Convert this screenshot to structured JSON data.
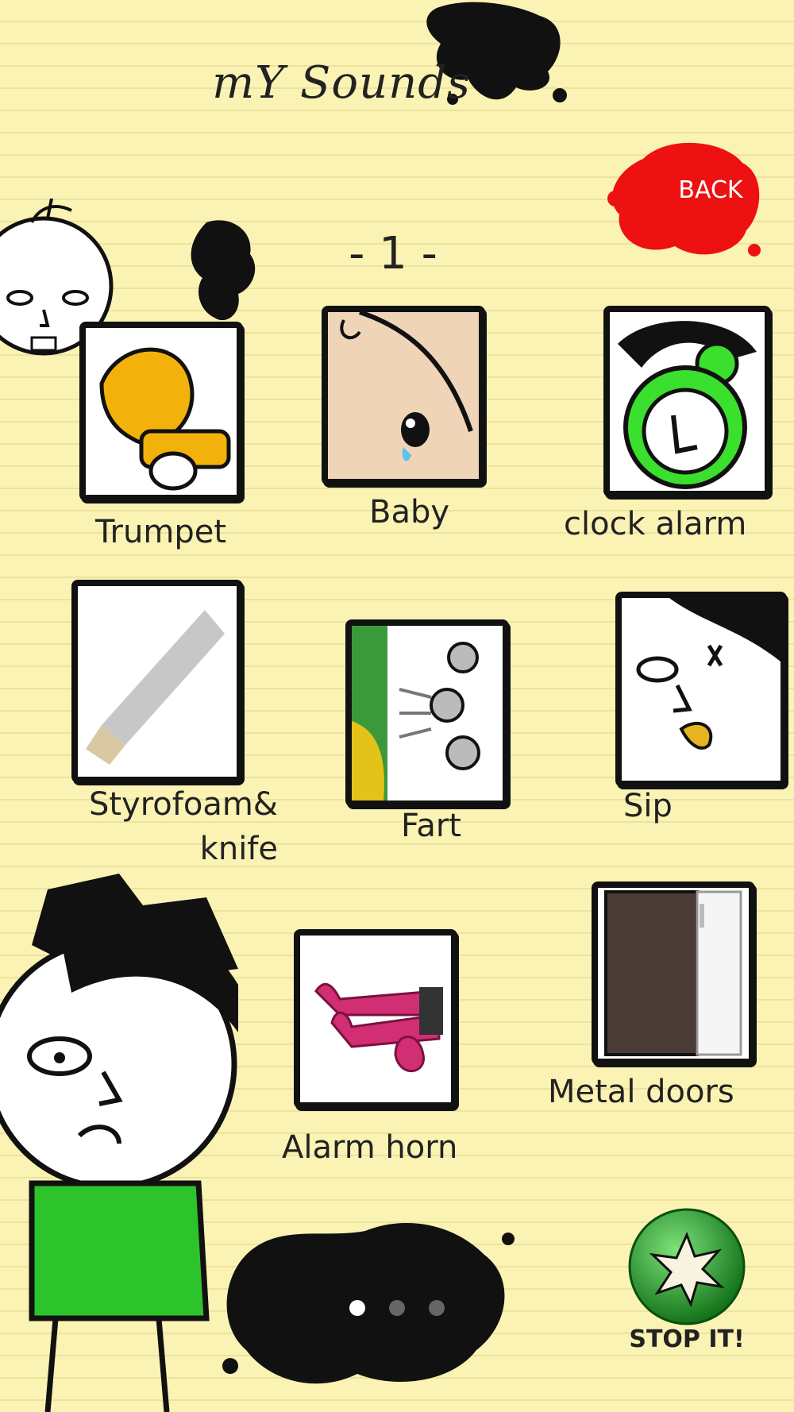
{
  "header": {
    "title": "mY Sounds",
    "page_number": "- 1 -"
  },
  "back_button": {
    "label": "BACK"
  },
  "sounds": [
    {
      "label": "Trumpet",
      "icon": "trumpet-icon"
    },
    {
      "label": "Baby",
      "icon": "crying-baby-icon"
    },
    {
      "label": "clock alarm",
      "icon": "alarm-clock-icon"
    },
    {
      "label": "Styrofoam&\nknife",
      "icon": "knife-icon"
    },
    {
      "label": "Fart",
      "icon": "fart-icon"
    },
    {
      "label": "Sip",
      "icon": "sip-face-icon"
    },
    {
      "label": "Alarm horn",
      "icon": "air-horn-icon"
    },
    {
      "label": "Metal doors",
      "icon": "metal-door-icon"
    }
  ],
  "pagination": {
    "total": 3,
    "current": 1
  },
  "stop_button": {
    "label": "STOP IT!"
  },
  "colors": {
    "paper": "#fbf3b4",
    "back_splash": "#ee1111",
    "stop_green": "#1f9f24"
  }
}
